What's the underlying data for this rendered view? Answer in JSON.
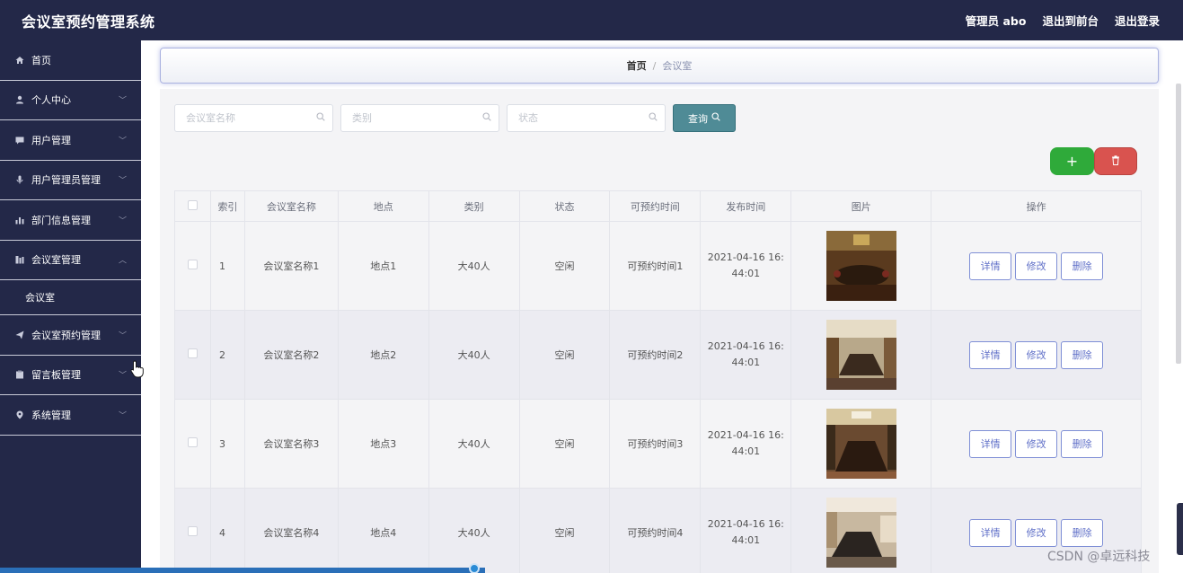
{
  "header": {
    "title": "会议室预约管理系统",
    "admin_label": "管理员 abo",
    "to_front": "退出到前台",
    "logout": "退出登录"
  },
  "sidebar": {
    "items": [
      {
        "label": "首页",
        "icon": "home-icon"
      },
      {
        "label": "个人中心",
        "icon": "user-icon"
      },
      {
        "label": "用户管理",
        "icon": "chat-icon"
      },
      {
        "label": "用户管理员管理",
        "icon": "mic-icon"
      },
      {
        "label": "部门信息管理",
        "icon": "bar-chart-icon"
      },
      {
        "label": "会议室管理",
        "icon": "building-icon"
      },
      {
        "label": "会议室预约管理",
        "icon": "send-icon"
      },
      {
        "label": "留言板管理",
        "icon": "clipboard-icon"
      },
      {
        "label": "系统管理",
        "icon": "location-icon"
      }
    ],
    "sub_item": "会议室"
  },
  "breadcrumb": {
    "home": "首页",
    "separator": "/",
    "current": "会议室"
  },
  "search": {
    "name_placeholder": "会议室名称",
    "type_placeholder": "类别",
    "status_placeholder": "状态",
    "query_label": "查询"
  },
  "table": {
    "headers": [
      "索引",
      "会议室名称",
      "地点",
      "类别",
      "状态",
      "可预约时间",
      "发布时间",
      "图片",
      "操作"
    ],
    "rows": [
      {
        "index": "1",
        "name": "会议室名称1",
        "location": "地点1",
        "type": "大40人",
        "status": "空闲",
        "available_time": "可预约时间1",
        "publish_time_1": "2021-04-16 16:",
        "publish_time_2": "44:01"
      },
      {
        "index": "2",
        "name": "会议室名称2",
        "location": "地点2",
        "type": "大40人",
        "status": "空闲",
        "available_time": "可预约时间2",
        "publish_time_1": "2021-04-16 16:",
        "publish_time_2": "44:01"
      },
      {
        "index": "3",
        "name": "会议室名称3",
        "location": "地点3",
        "type": "大40人",
        "status": "空闲",
        "available_time": "可预约时间3",
        "publish_time_1": "2021-04-16 16:",
        "publish_time_2": "44:01"
      },
      {
        "index": "4",
        "name": "会议室名称4",
        "location": "地点4",
        "type": "大40人",
        "status": "空闲",
        "available_time": "可预约时间4",
        "publish_time_1": "2021-04-16 16:",
        "publish_time_2": "44:01"
      }
    ],
    "actions": {
      "detail": "详情",
      "edit": "修改",
      "delete": "删除"
    }
  },
  "buttons": {
    "add": "+",
    "batch_delete_icon": "trash-icon"
  },
  "watermark": "CSDN @卓远科技",
  "colors": {
    "header_bg": "#232848",
    "query_btn": "#4f8b96",
    "add_btn": "#2faa3a",
    "delete_btn": "#d9534f",
    "action_btn_border": "#7f8fd6"
  }
}
